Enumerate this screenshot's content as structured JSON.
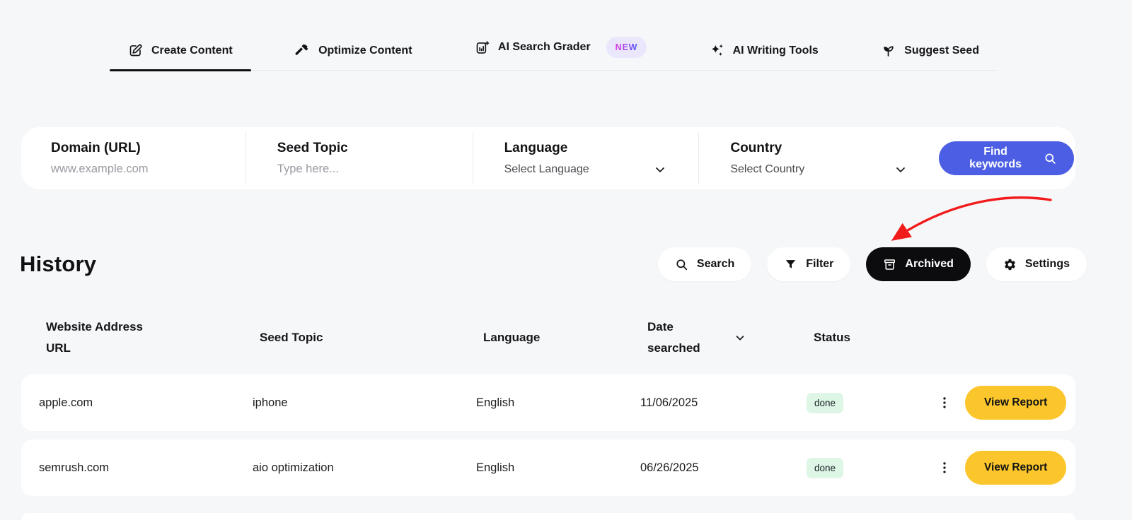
{
  "tabs": {
    "items": [
      {
        "label": "Create Content",
        "icon": "edit-icon",
        "active": true
      },
      {
        "label": "Optimize Content",
        "icon": "hammer-icon",
        "active": false
      },
      {
        "label": "AI Search Grader",
        "icon": "search-grader-icon",
        "badge": "NEW",
        "active": false
      },
      {
        "label": "AI Writing Tools",
        "icon": "sparkles-icon",
        "active": false
      },
      {
        "label": "Suggest Seed",
        "icon": "sprout-icon",
        "active": false
      }
    ]
  },
  "search_form": {
    "fields": [
      {
        "label": "Domain (URL)",
        "placeholder": "www.example.com",
        "type": "text"
      },
      {
        "label": "Seed Topic",
        "placeholder": "Type here...",
        "type": "text"
      },
      {
        "label": "Language",
        "value": "Select Language",
        "type": "select"
      },
      {
        "label": "Country",
        "value": "Select Country",
        "type": "select"
      }
    ],
    "submit": {
      "label": "Find keywords",
      "icon": "search-icon"
    }
  },
  "history": {
    "title": "History",
    "toolbar": [
      {
        "label": "Search",
        "icon": "search-icon",
        "active": false
      },
      {
        "label": "Filter",
        "icon": "filter-icon",
        "active": false
      },
      {
        "label": "Archived",
        "icon": "archive-icon",
        "active": true
      },
      {
        "label": "Settings",
        "icon": "gear-icon",
        "active": false
      }
    ]
  },
  "table": {
    "columns": [
      "Website Address URL",
      "Seed Topic",
      "Language",
      "Date searched",
      "Status"
    ],
    "rows": [
      {
        "url": "apple.com",
        "seed_topic": "iphone",
        "language": "English",
        "date_searched": "11/06/2025",
        "status": "done",
        "action_label": "View Report"
      },
      {
        "url": "semrush.com",
        "seed_topic": "aio optimization",
        "language": "English",
        "date_searched": "06/26/2025",
        "status": "done",
        "action_label": "View Report"
      }
    ]
  },
  "colors": {
    "background": "#f6f7f9",
    "primary_button": "#4c5fe4",
    "action_button": "#fbc62b",
    "active_pill": "#0c0c0e",
    "status_done_bg": "#ddf6e5",
    "new_badge_bg": "#eae6fb",
    "new_badge_gradient": [
      "#d23fe0",
      "#5b5bf5"
    ],
    "annotation_arrow": "#f21b1b",
    "tab_underline": "#101013"
  }
}
